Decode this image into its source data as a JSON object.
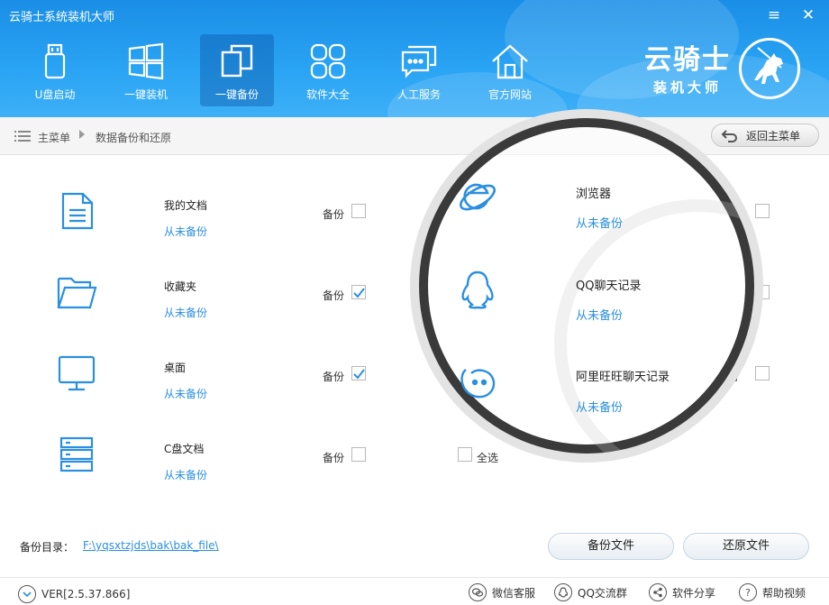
{
  "app": {
    "title": "云骑士系统装机大师"
  },
  "window": {
    "minimize": "≡",
    "close": "✕"
  },
  "nav": [
    {
      "label": "U盘启动",
      "icon": "usb-drive-icon"
    },
    {
      "label": "一键装机",
      "icon": "windows-icon"
    },
    {
      "label": "一键备份",
      "icon": "backup-copy-icon",
      "active": true
    },
    {
      "label": "软件大全",
      "icon": "apps-grid-icon"
    },
    {
      "label": "人工服务",
      "icon": "chat-bubble-icon"
    },
    {
      "label": "官方网站",
      "icon": "home-icon"
    }
  ],
  "brand": {
    "name": "云骑士",
    "sub": "装机大师"
  },
  "breadcrumb": {
    "home": "主菜单",
    "current": "数据备份和还原"
  },
  "back_button": "返回主菜单",
  "items_left": [
    {
      "title": "我的文档",
      "status": "从未备份",
      "backup_label": "备份",
      "checked": false,
      "icon": "document-icon"
    },
    {
      "title": "收藏夹",
      "status": "从未备份",
      "backup_label": "备份",
      "checked": true,
      "icon": "folder-icon"
    },
    {
      "title": "桌面",
      "status": "从未备份",
      "backup_label": "备份",
      "checked": true,
      "icon": "monitor-icon"
    },
    {
      "title": "C盘文档",
      "status": "从未备份",
      "backup_label": "备份",
      "checked": false,
      "icon": "server-icon"
    }
  ],
  "items_right": [
    {
      "title": "浏览器",
      "status": "从未备份",
      "icon": "ie-browser-icon"
    },
    {
      "title": "QQ聊天记录",
      "status": "从未备份",
      "icon": "qq-penguin-icon"
    },
    {
      "title": "阿里旺旺聊天记录",
      "status": "从未备份",
      "icon": "wangwang-icon"
    }
  ],
  "right_partial_labels": [
    "》",
    "",
    "份"
  ],
  "select_all": "全选",
  "backup_dir": {
    "label": "备份目录：",
    "path": "F:\\yqsxtzjds\\bak\\bak_file\\"
  },
  "buttons": {
    "backup": "备份文件",
    "restore": "还原文件"
  },
  "footer": {
    "version": "VER[2.5.37.866]",
    "wechat": "微信客服",
    "qq_group": "QQ交流群",
    "share": "软件分享",
    "help": "帮助视频"
  },
  "colors": {
    "header": "#2aa4f4",
    "link": "#2a8fe0",
    "icon": "#2a8fe0"
  }
}
